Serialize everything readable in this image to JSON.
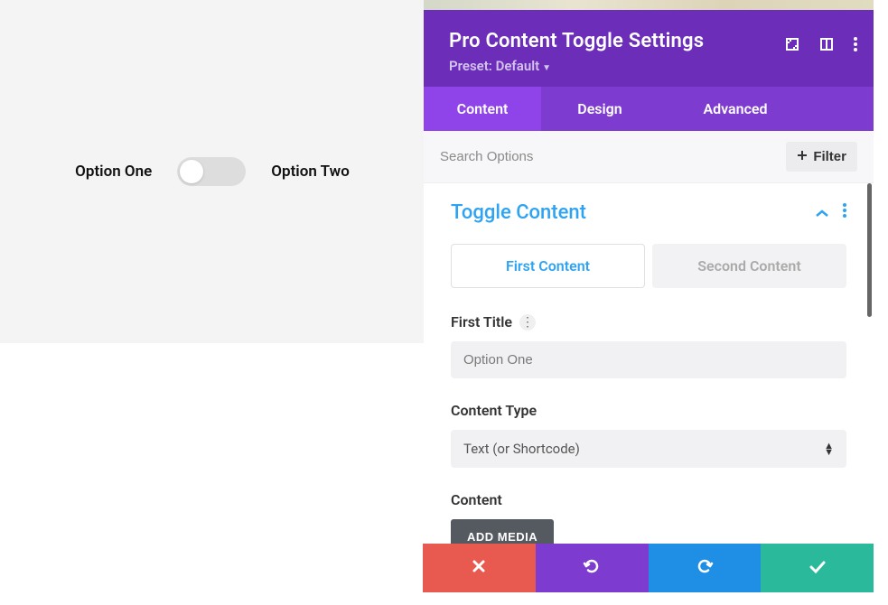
{
  "preview": {
    "option_one": "Option One",
    "option_two": "Option Two"
  },
  "panel": {
    "title": "Pro Content Toggle Settings",
    "preset_label": "Preset: Default",
    "tabs": {
      "content": "Content",
      "design": "Design",
      "advanced": "Advanced"
    },
    "search_placeholder": "Search Options",
    "filter_label": "Filter"
  },
  "section": {
    "title": "Toggle Content",
    "content_tabs": {
      "first": "First Content",
      "second": "Second Content"
    },
    "fields": {
      "first_title_label": "First Title",
      "first_title_value": "Option One",
      "content_type_label": "Content Type",
      "content_type_value": "Text (or Shortcode)",
      "content_label": "Content",
      "add_media_label": "ADD MEDIA"
    }
  }
}
